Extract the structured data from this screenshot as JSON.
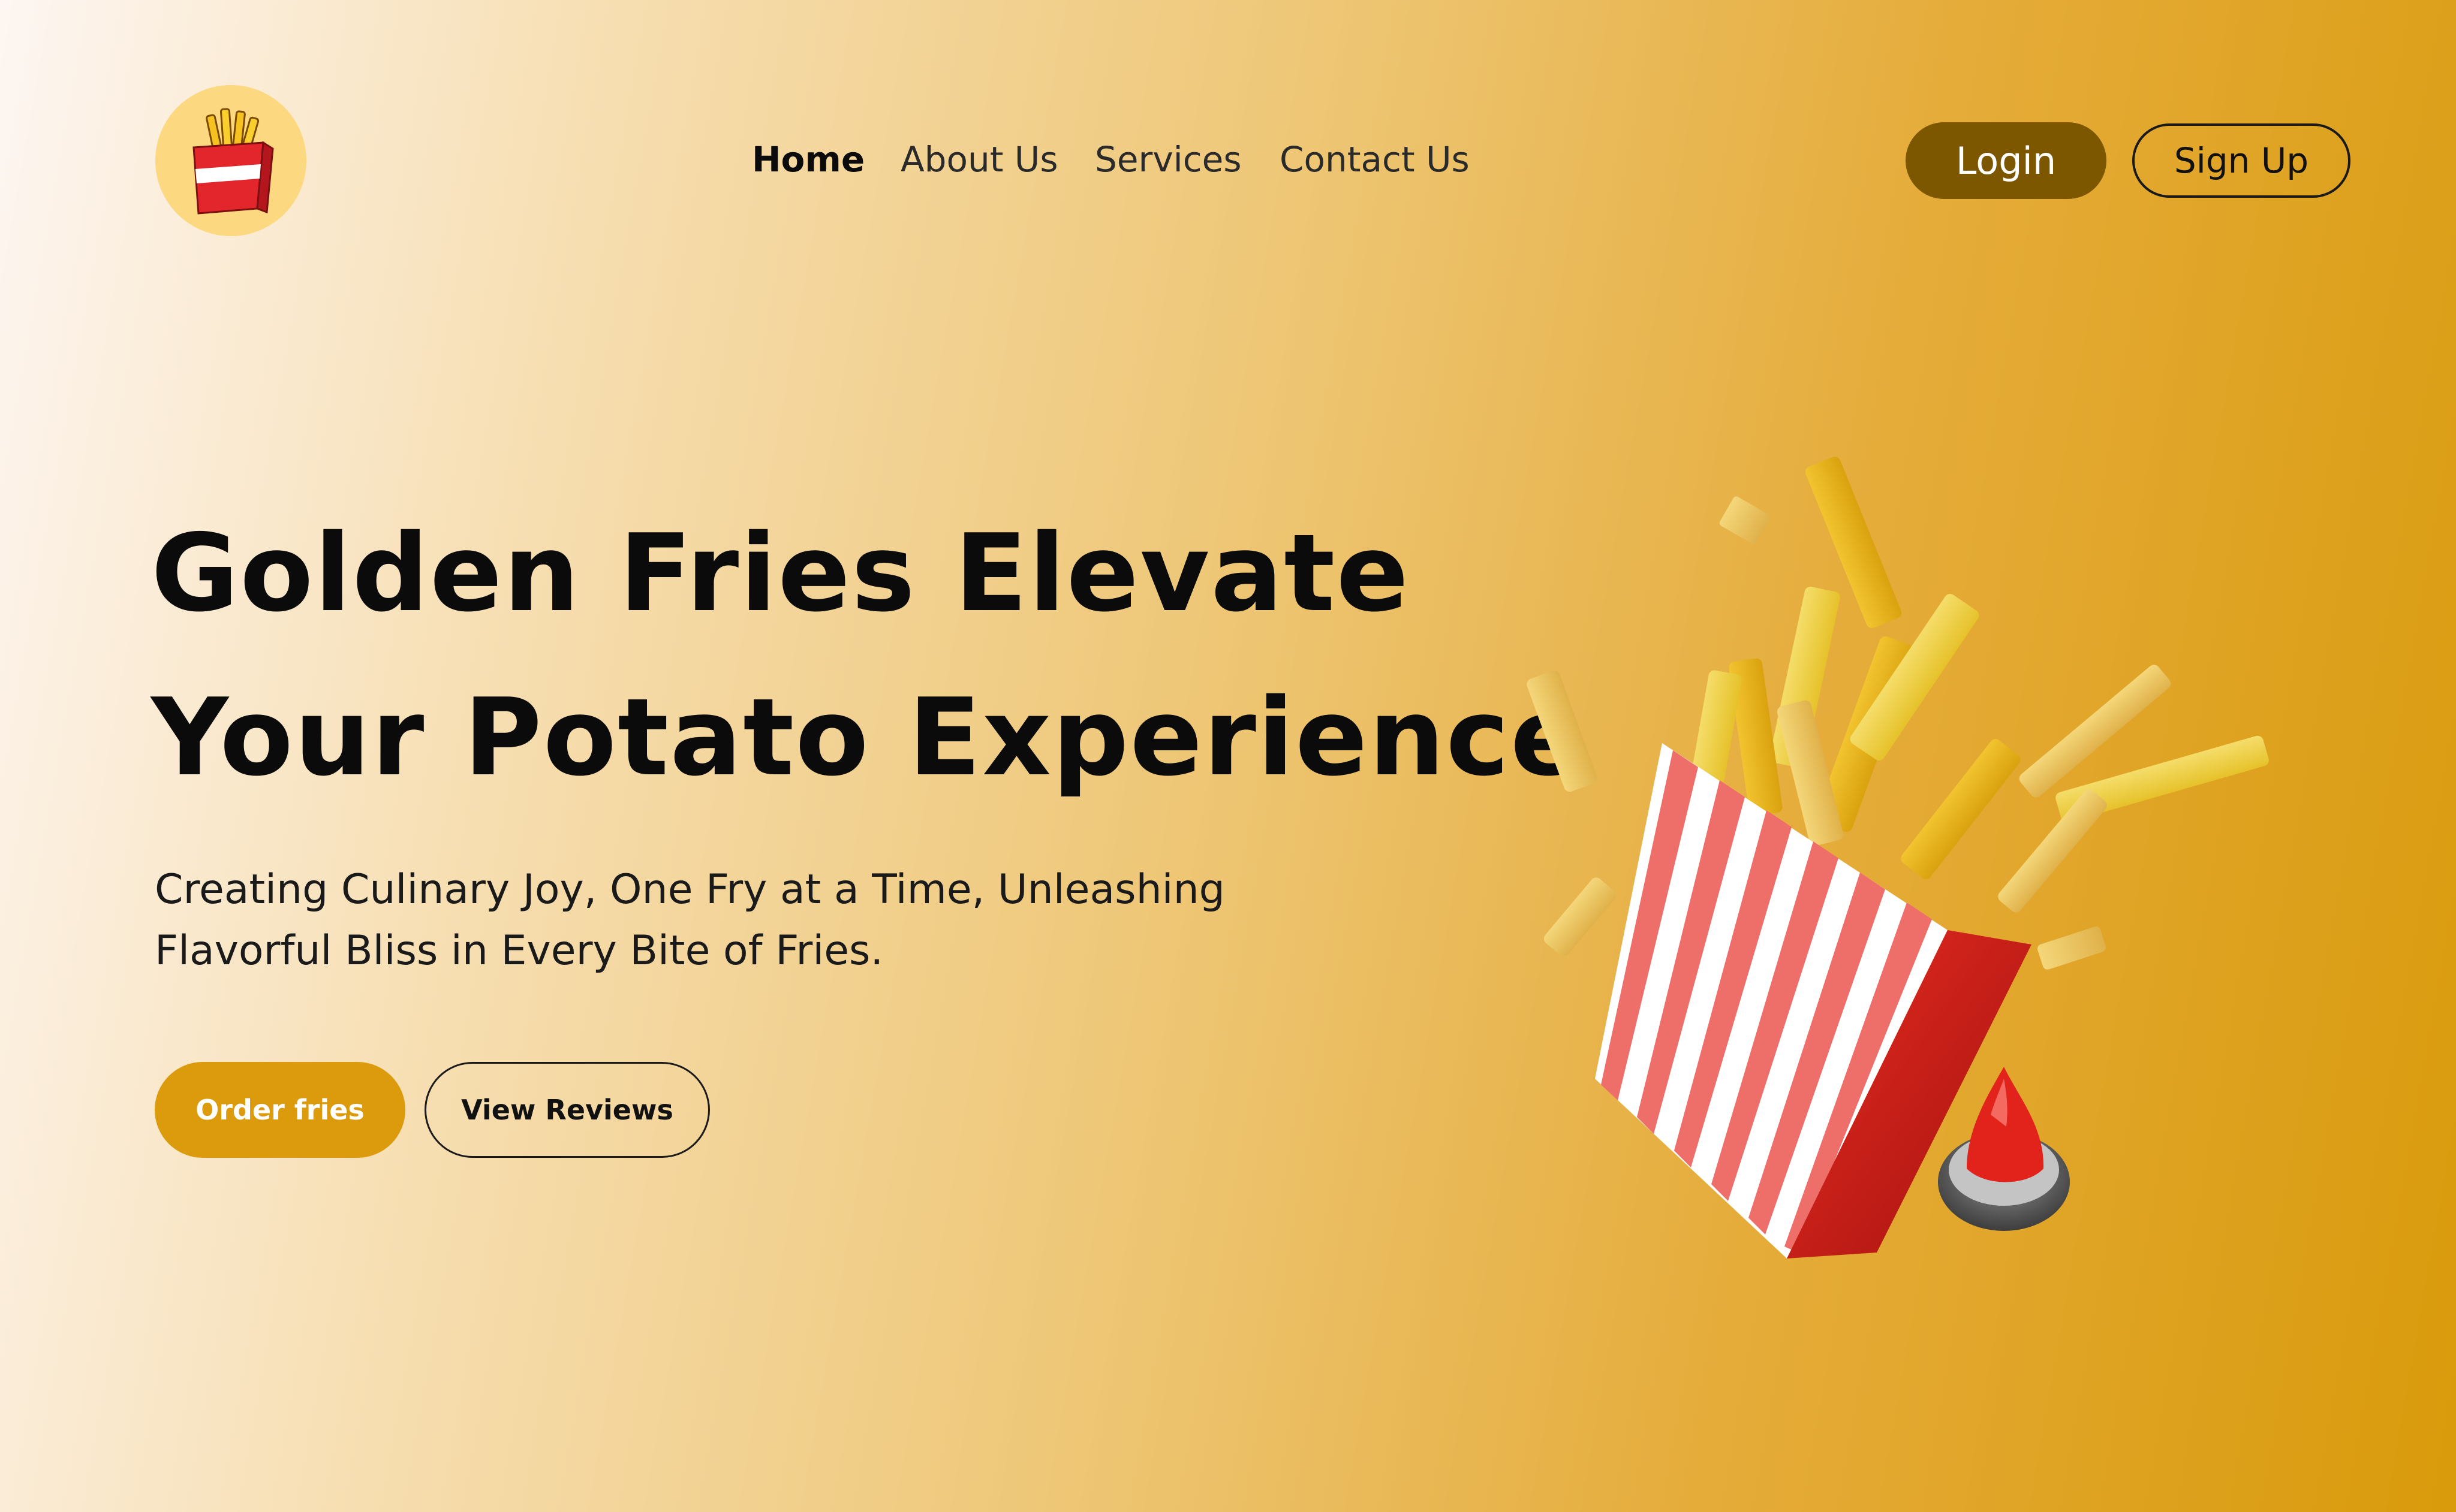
{
  "brand": {
    "logo_icon": "fries-box-icon",
    "logo_bg_color": "#fcd880"
  },
  "nav": {
    "items": [
      {
        "label": "Home",
        "active": true
      },
      {
        "label": "About Us",
        "active": false
      },
      {
        "label": "Services",
        "active": false
      },
      {
        "label": "Contact Us",
        "active": false
      }
    ]
  },
  "auth": {
    "login_label": "Login",
    "signup_label": "Sign Up",
    "login_color": "#7d5600"
  },
  "hero": {
    "headline_line1": "Golden Fries Elevate",
    "headline_line2": "Your Potato Experience",
    "subtitle_line1": "Creating Culinary Joy, One Fry at a Time, Unleashing",
    "subtitle_line2": "Flavorful Bliss in Every Bite of Fries.",
    "primary_cta": "Order fries",
    "secondary_cta": "View Reviews",
    "accent_color": "#dc9b0d",
    "illustration": "fries-carton-with-ketchup-illustration"
  }
}
